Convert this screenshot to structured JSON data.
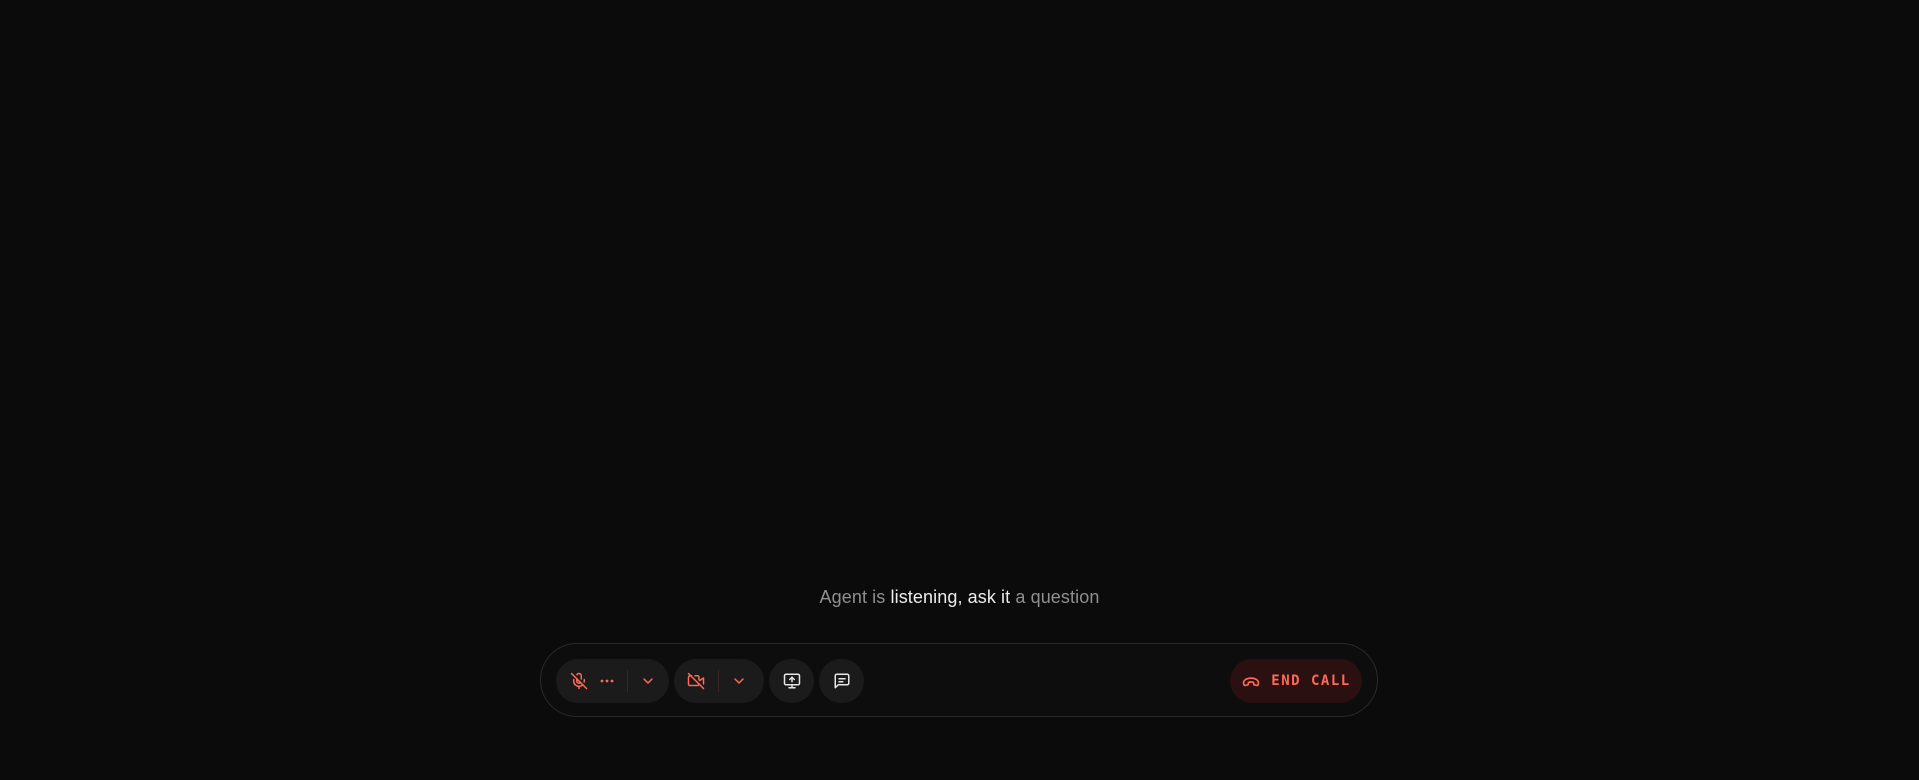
{
  "status": {
    "prefix": "Agent is ",
    "highlight": "listening, ask it",
    "suffix": " a question"
  },
  "controls": {
    "mic": {
      "icon": "mic-off-icon",
      "more_icon": "ellipsis-icon",
      "dropdown_icon": "chevron-down-icon",
      "state": "muted"
    },
    "camera": {
      "icon": "camera-off-icon",
      "dropdown_icon": "chevron-down-icon",
      "state": "off"
    },
    "share_screen": {
      "icon": "screen-share-icon"
    },
    "chat": {
      "icon": "chat-icon"
    },
    "end_call": {
      "icon": "phone-hangup-icon",
      "label": "END CALL"
    }
  },
  "colors": {
    "background": "#0b0b0b",
    "accent_red": "#ff6a55",
    "end_call_bg": "#2a1010",
    "button_bg": "#1b1b1b",
    "icon_neutral": "#e6e6e6",
    "status_text": "#8f8f8f",
    "status_highlight": "#ececec"
  }
}
